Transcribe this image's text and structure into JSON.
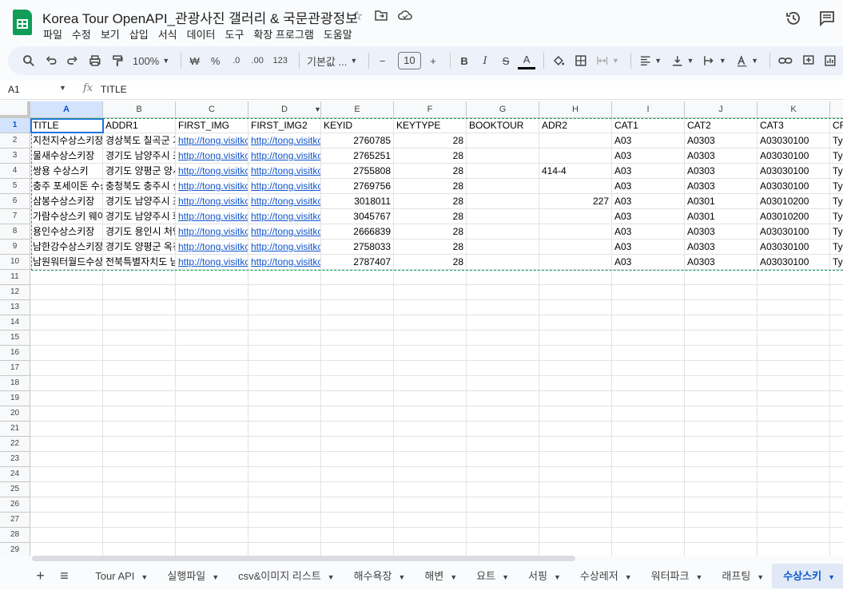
{
  "doc": {
    "title": "Korea Tour OpenAPI_관광사진 갤러리 & 국문관광정보"
  },
  "menu": [
    "파일",
    "수정",
    "보기",
    "삽입",
    "서식",
    "데이터",
    "도구",
    "확장 프로그램",
    "도움말"
  ],
  "toolbar": {
    "zoom": "100%",
    "currency": "₩",
    "percent": "%",
    "dec_decrease": ".0",
    "dec_increase": ".00",
    "format_123": "123",
    "font": "기본값 ...",
    "font_size": "10",
    "bold": "B",
    "italic": "I",
    "strike": "S",
    "text_color": "A"
  },
  "formula_bar": {
    "cell_ref": "A1",
    "fx": "fx",
    "value": "TITLE"
  },
  "columns": [
    "A",
    "B",
    "C",
    "D",
    "E",
    "F",
    "G",
    "H",
    "I",
    "J",
    "K"
  ],
  "row_numbers": [
    "1",
    "2",
    "3",
    "4",
    "5",
    "6",
    "7",
    "8",
    "9",
    "10",
    "11",
    "12",
    "13",
    "14",
    "15",
    "16",
    "17",
    "18",
    "19",
    "20",
    "21",
    "22",
    "23",
    "24",
    "25",
    "26",
    "27",
    "28",
    "29"
  ],
  "rows": [
    [
      "TITLE",
      "ADDR1",
      "FIRST_IMG",
      "FIRST_IMG2",
      "KEYID",
      "KEYTYPE",
      "BOOKTOUR",
      "ADR2",
      "CAT1",
      "CAT2",
      "CAT3",
      "CR"
    ],
    [
      "지천지수상스키장",
      "경상북도 칠곡군 기",
      "http://tong.visitkc",
      "http://tong.visitkc",
      "2760785",
      "28",
      "",
      "",
      "A03",
      "A0303",
      "A03030100",
      "Ty"
    ],
    [
      "물새수상스키장",
      "경기도 남양주시 조",
      "http://tong.visitkc",
      "http://tong.visitkc",
      "2765251",
      "28",
      "",
      "",
      "A03",
      "A0303",
      "A03030100",
      "Ty"
    ],
    [
      "쌍용 수상스키",
      "경기도 양평군 양서",
      "http://tong.visitkc",
      "http://tong.visitkc",
      "2755808",
      "28",
      "",
      "414-4",
      "A03",
      "A0303",
      "A03030100",
      "Ty"
    ],
    [
      "충주 포세이돈 수상",
      "충청북도 충주시 실",
      "http://tong.visitkc",
      "http://tong.visitkc",
      "2769756",
      "28",
      "",
      "",
      "A03",
      "A0303",
      "A03030100",
      "Ty"
    ],
    [
      "삼봉수상스키장",
      "경기도 남양주시 조",
      "http://tong.visitkc",
      "http://tong.visitkc",
      "3018011",
      "28",
      "",
      "227",
      "A03",
      "A0301",
      "A03010200",
      "Ty"
    ],
    [
      "가람수상스키 웨이",
      "경기도 남양주시 화",
      "http://tong.visitkc",
      "http://tong.visitkc",
      "3045767",
      "28",
      "",
      "",
      "A03",
      "A0301",
      "A03010200",
      "Ty"
    ],
    [
      "용인수상스키장",
      "경기도 용인시 처인",
      "http://tong.visitkc",
      "http://tong.visitkc",
      "2666839",
      "28",
      "",
      "",
      "A03",
      "A0303",
      "A03030100",
      "Ty"
    ],
    [
      "남한강수상스키장",
      "경기도 양평군 옥천",
      "http://tong.visitkc",
      "http://tong.visitkc",
      "2758033",
      "28",
      "",
      "",
      "A03",
      "A0303",
      "A03030100",
      "Ty"
    ],
    [
      "남원워터월드수상",
      "전북특별자치도 남",
      "http://tong.visitkc",
      "http://tong.visitkc",
      "2787407",
      "28",
      "",
      "",
      "A03",
      "A0303",
      "A03030100",
      "Ty"
    ]
  ],
  "sheet_tabs": {
    "add": "+",
    "list": "≡",
    "tabs": [
      "Tour API",
      "실행파일",
      "csv&이미지 리스트",
      "해수욕장",
      "해변",
      "요트",
      "서핑",
      "수상레저",
      "워터파크",
      "래프팅",
      "수상스키"
    ],
    "active": "수상스키"
  },
  "colors": {
    "accent": "#0b57d0",
    "sheets_green": "#0f9d58",
    "link": "#1155cc"
  }
}
